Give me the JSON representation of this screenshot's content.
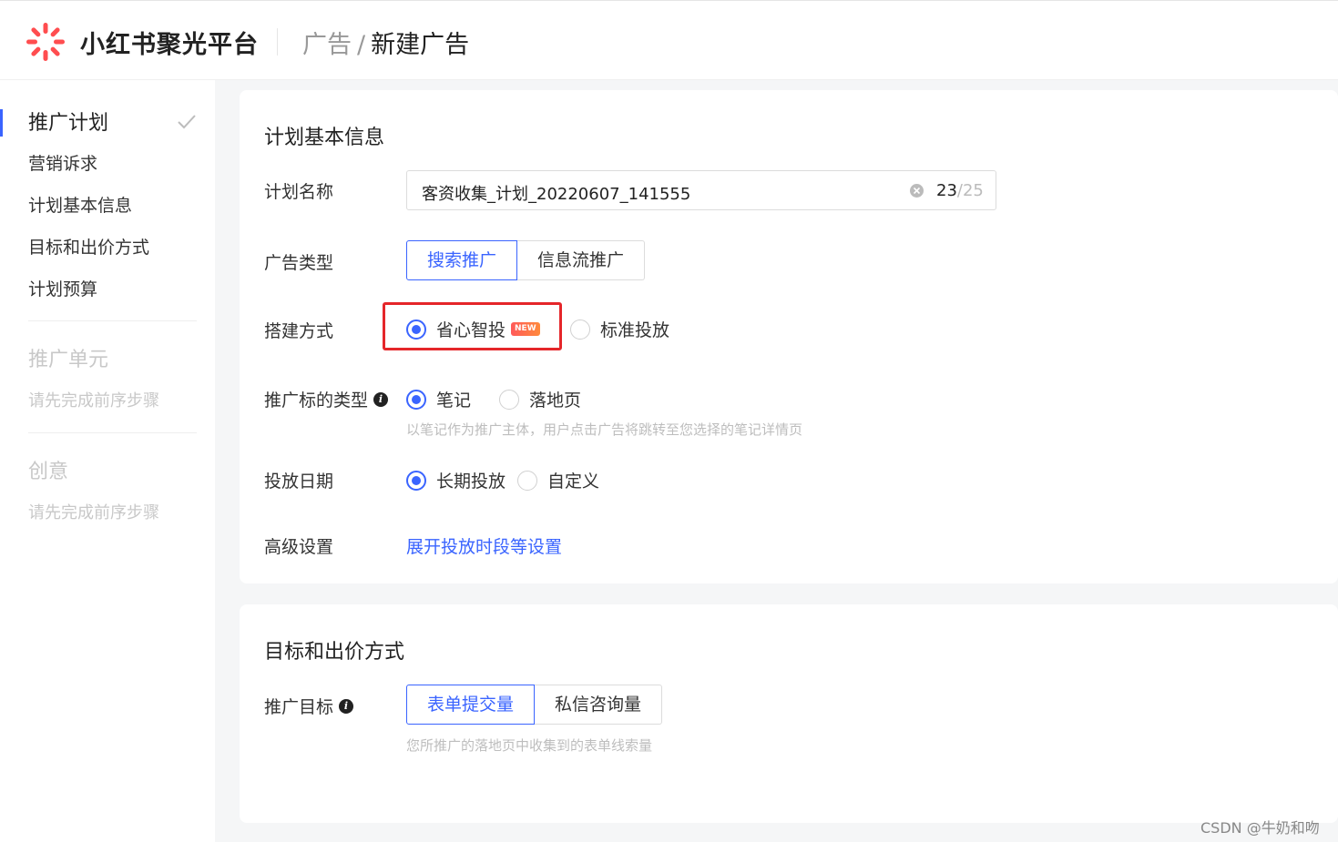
{
  "header": {
    "brand": "小红书聚光平台",
    "breadcrumb_parent": "广告",
    "breadcrumb_sep": "/",
    "breadcrumb_current": "新建广告"
  },
  "sidebar": {
    "section1_title": "推广计划",
    "section1_items": [
      "营销诉求",
      "计划基本信息",
      "目标和出价方式",
      "计划预算"
    ],
    "section2_title": "推广单元",
    "section2_sub": "请先完成前序步骤",
    "section3_title": "创意",
    "section3_sub": "请先完成前序步骤"
  },
  "card1": {
    "title": "计划基本信息",
    "plan_name_label": "计划名称",
    "plan_name_value": "客资收集_计划_20220607_141555",
    "count_current": "23",
    "count_sep": "/",
    "count_max": "25",
    "ad_type_label": "广告类型",
    "ad_type_options": [
      "搜索推广",
      "信息流推广"
    ],
    "build_label": "搭建方式",
    "build_options": [
      "省心智投",
      "标准投放"
    ],
    "new_badge": "NEW",
    "target_type_label": "推广标的类型",
    "target_type_options": [
      "笔记",
      "落地页"
    ],
    "target_type_hint": "以笔记作为推广主体，用户点击广告将跳转至您选择的笔记详情页",
    "date_label": "投放日期",
    "date_options": [
      "长期投放",
      "自定义"
    ],
    "advanced_label": "高级设置",
    "advanced_link": "展开投放时段等设置"
  },
  "card2": {
    "title": "目标和出价方式",
    "goal_label": "推广目标",
    "goal_options": [
      "表单提交量",
      "私信咨询量"
    ],
    "goal_hint": "您所推广的落地页中收集到的表单线索量"
  },
  "watermark": "CSDN @牛奶和吻",
  "colors": {
    "accent": "#3a64ff",
    "highlight": "#e5262a",
    "brand_logo": "#ff4d4f"
  }
}
